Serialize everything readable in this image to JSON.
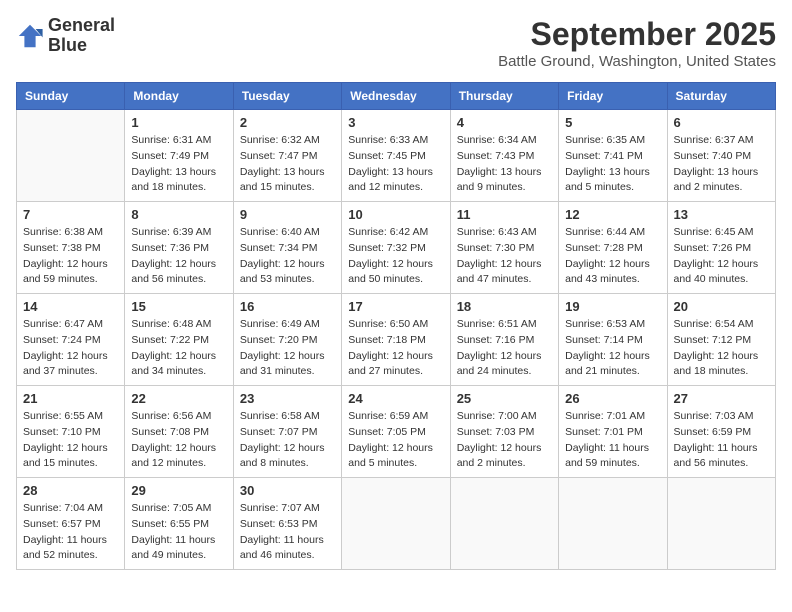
{
  "logo": {
    "line1": "General",
    "line2": "Blue"
  },
  "title": "September 2025",
  "location": "Battle Ground, Washington, United States",
  "days_of_week": [
    "Sunday",
    "Monday",
    "Tuesday",
    "Wednesday",
    "Thursday",
    "Friday",
    "Saturday"
  ],
  "weeks": [
    [
      {
        "day": "",
        "info": ""
      },
      {
        "day": "1",
        "info": "Sunrise: 6:31 AM\nSunset: 7:49 PM\nDaylight: 13 hours\nand 18 minutes."
      },
      {
        "day": "2",
        "info": "Sunrise: 6:32 AM\nSunset: 7:47 PM\nDaylight: 13 hours\nand 15 minutes."
      },
      {
        "day": "3",
        "info": "Sunrise: 6:33 AM\nSunset: 7:45 PM\nDaylight: 13 hours\nand 12 minutes."
      },
      {
        "day": "4",
        "info": "Sunrise: 6:34 AM\nSunset: 7:43 PM\nDaylight: 13 hours\nand 9 minutes."
      },
      {
        "day": "5",
        "info": "Sunrise: 6:35 AM\nSunset: 7:41 PM\nDaylight: 13 hours\nand 5 minutes."
      },
      {
        "day": "6",
        "info": "Sunrise: 6:37 AM\nSunset: 7:40 PM\nDaylight: 13 hours\nand 2 minutes."
      }
    ],
    [
      {
        "day": "7",
        "info": "Sunrise: 6:38 AM\nSunset: 7:38 PM\nDaylight: 12 hours\nand 59 minutes."
      },
      {
        "day": "8",
        "info": "Sunrise: 6:39 AM\nSunset: 7:36 PM\nDaylight: 12 hours\nand 56 minutes."
      },
      {
        "day": "9",
        "info": "Sunrise: 6:40 AM\nSunset: 7:34 PM\nDaylight: 12 hours\nand 53 minutes."
      },
      {
        "day": "10",
        "info": "Sunrise: 6:42 AM\nSunset: 7:32 PM\nDaylight: 12 hours\nand 50 minutes."
      },
      {
        "day": "11",
        "info": "Sunrise: 6:43 AM\nSunset: 7:30 PM\nDaylight: 12 hours\nand 47 minutes."
      },
      {
        "day": "12",
        "info": "Sunrise: 6:44 AM\nSunset: 7:28 PM\nDaylight: 12 hours\nand 43 minutes."
      },
      {
        "day": "13",
        "info": "Sunrise: 6:45 AM\nSunset: 7:26 PM\nDaylight: 12 hours\nand 40 minutes."
      }
    ],
    [
      {
        "day": "14",
        "info": "Sunrise: 6:47 AM\nSunset: 7:24 PM\nDaylight: 12 hours\nand 37 minutes."
      },
      {
        "day": "15",
        "info": "Sunrise: 6:48 AM\nSunset: 7:22 PM\nDaylight: 12 hours\nand 34 minutes."
      },
      {
        "day": "16",
        "info": "Sunrise: 6:49 AM\nSunset: 7:20 PM\nDaylight: 12 hours\nand 31 minutes."
      },
      {
        "day": "17",
        "info": "Sunrise: 6:50 AM\nSunset: 7:18 PM\nDaylight: 12 hours\nand 27 minutes."
      },
      {
        "day": "18",
        "info": "Sunrise: 6:51 AM\nSunset: 7:16 PM\nDaylight: 12 hours\nand 24 minutes."
      },
      {
        "day": "19",
        "info": "Sunrise: 6:53 AM\nSunset: 7:14 PM\nDaylight: 12 hours\nand 21 minutes."
      },
      {
        "day": "20",
        "info": "Sunrise: 6:54 AM\nSunset: 7:12 PM\nDaylight: 12 hours\nand 18 minutes."
      }
    ],
    [
      {
        "day": "21",
        "info": "Sunrise: 6:55 AM\nSunset: 7:10 PM\nDaylight: 12 hours\nand 15 minutes."
      },
      {
        "day": "22",
        "info": "Sunrise: 6:56 AM\nSunset: 7:08 PM\nDaylight: 12 hours\nand 12 minutes."
      },
      {
        "day": "23",
        "info": "Sunrise: 6:58 AM\nSunset: 7:07 PM\nDaylight: 12 hours\nand 8 minutes."
      },
      {
        "day": "24",
        "info": "Sunrise: 6:59 AM\nSunset: 7:05 PM\nDaylight: 12 hours\nand 5 minutes."
      },
      {
        "day": "25",
        "info": "Sunrise: 7:00 AM\nSunset: 7:03 PM\nDaylight: 12 hours\nand 2 minutes."
      },
      {
        "day": "26",
        "info": "Sunrise: 7:01 AM\nSunset: 7:01 PM\nDaylight: 11 hours\nand 59 minutes."
      },
      {
        "day": "27",
        "info": "Sunrise: 7:03 AM\nSunset: 6:59 PM\nDaylight: 11 hours\nand 56 minutes."
      }
    ],
    [
      {
        "day": "28",
        "info": "Sunrise: 7:04 AM\nSunset: 6:57 PM\nDaylight: 11 hours\nand 52 minutes."
      },
      {
        "day": "29",
        "info": "Sunrise: 7:05 AM\nSunset: 6:55 PM\nDaylight: 11 hours\nand 49 minutes."
      },
      {
        "day": "30",
        "info": "Sunrise: 7:07 AM\nSunset: 6:53 PM\nDaylight: 11 hours\nand 46 minutes."
      },
      {
        "day": "",
        "info": ""
      },
      {
        "day": "",
        "info": ""
      },
      {
        "day": "",
        "info": ""
      },
      {
        "day": "",
        "info": ""
      }
    ]
  ]
}
